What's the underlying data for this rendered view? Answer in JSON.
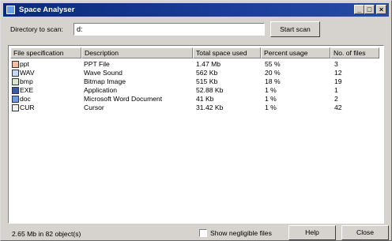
{
  "window": {
    "title": "Space Analyser",
    "controls": [
      "_",
      "□",
      "×"
    ]
  },
  "scan": {
    "label": "Directory to scan:",
    "value": "d:",
    "start_button": "Start scan"
  },
  "table": {
    "columns": [
      "File specification",
      "Description",
      "Total space used",
      "Percent usage",
      "No. of files"
    ],
    "rows": [
      {
        "icon": "ppt-file-icon",
        "spec": "ppt",
        "desc": "PPT File",
        "space": "1.47 Mb",
        "percent": "55 %",
        "count": "3"
      },
      {
        "icon": "wav-file-icon",
        "spec": "WAV",
        "desc": "Wave Sound",
        "space": "562 Kb",
        "percent": "20 %",
        "count": "12"
      },
      {
        "icon": "bmp-file-icon",
        "spec": "bmp",
        "desc": "Bitmap Image",
        "space": "515 Kb",
        "percent": "18 %",
        "count": "19"
      },
      {
        "icon": "exe-file-icon",
        "spec": "EXE",
        "desc": "Application",
        "space": "52.88 Kb",
        "percent": "1 %",
        "count": "1"
      },
      {
        "icon": "doc-file-icon",
        "spec": "doc",
        "desc": "Microsoft Word Document",
        "space": "41 Kb",
        "percent": "1 %",
        "count": "2"
      },
      {
        "icon": "cur-file-icon",
        "spec": "CUR",
        "desc": "Cursor",
        "space": "31.42 Kb",
        "percent": "1 %",
        "count": "42"
      }
    ]
  },
  "footer": {
    "status": "2.65 Mb in 82 object(s)",
    "checkbox_label": "Show negligible files",
    "checkbox_checked": false,
    "help_button": "Help",
    "close_button": "Close"
  },
  "colors": {
    "titlebar": "#0c2a7a",
    "face": "#d6d3ce",
    "list_bg": "#ffffff"
  }
}
